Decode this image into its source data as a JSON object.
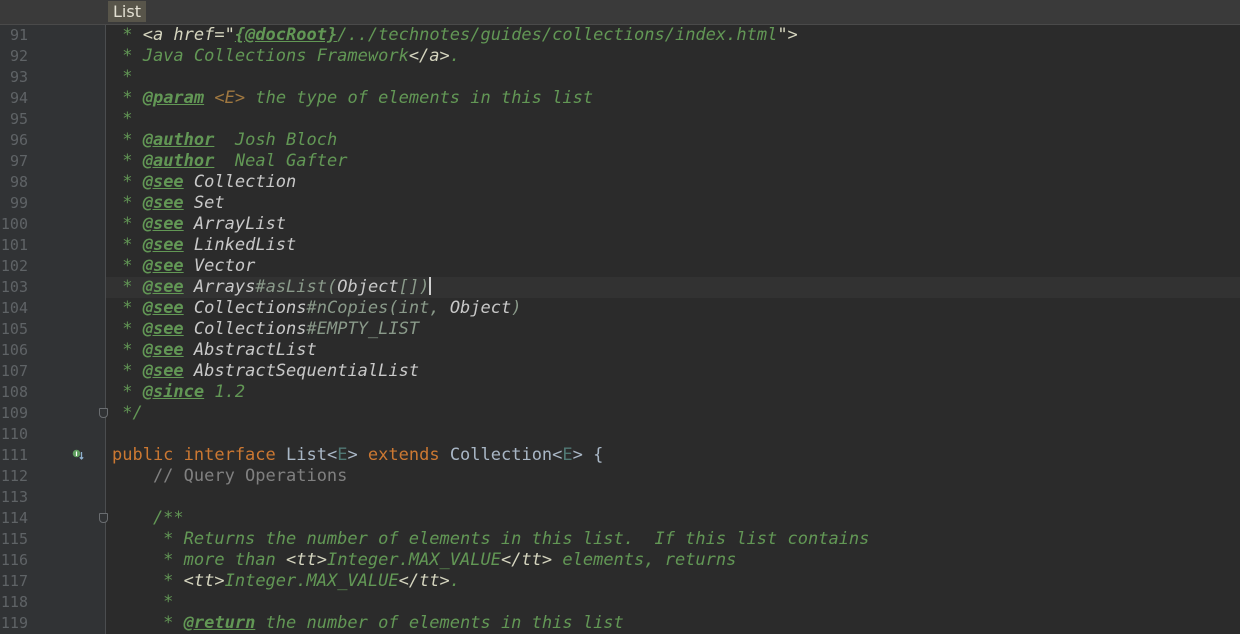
{
  "breadcrumb": {
    "label": "List"
  },
  "colors": {
    "doc": "#629755",
    "keyword": "#cc7832",
    "identifier": "#a9b7c6",
    "comment": "#808080"
  },
  "lines": [
    {
      "n": "91",
      "code": [
        [
          "doc",
          " * "
        ],
        [
          "html",
          "<a href=\""
        ],
        [
          "tag",
          "{@docRoot}"
        ],
        [
          "doc",
          "/../technotes/guides/collections/index.html"
        ],
        [
          "html",
          "\">"
        ]
      ]
    },
    {
      "n": "92",
      "code": [
        [
          "doc",
          " * Java Collections Framework"
        ],
        [
          "html",
          "</a>"
        ],
        [
          "doc",
          "."
        ]
      ]
    },
    {
      "n": "93",
      "code": [
        [
          "doc",
          " *"
        ]
      ]
    },
    {
      "n": "94",
      "code": [
        [
          "doc",
          " * "
        ],
        [
          "tag",
          "@param"
        ],
        [
          "doc",
          " "
        ],
        [
          "tp",
          "<E>"
        ],
        [
          "doc",
          " the type of elements in this list"
        ]
      ]
    },
    {
      "n": "95",
      "code": [
        [
          "doc",
          " *"
        ]
      ]
    },
    {
      "n": "96",
      "code": [
        [
          "doc",
          " * "
        ],
        [
          "tag",
          "@author"
        ],
        [
          "doc",
          "  Josh Bloch"
        ]
      ]
    },
    {
      "n": "97",
      "code": [
        [
          "doc",
          " * "
        ],
        [
          "tag",
          "@author"
        ],
        [
          "doc",
          "  Neal Gafter"
        ]
      ]
    },
    {
      "n": "98",
      "code": [
        [
          "doc",
          " * "
        ],
        [
          "tag",
          "@see"
        ],
        [
          "doc",
          " "
        ],
        [
          "refb",
          "Collection"
        ]
      ]
    },
    {
      "n": "99",
      "code": [
        [
          "doc",
          " * "
        ],
        [
          "tag",
          "@see"
        ],
        [
          "doc",
          " "
        ],
        [
          "refb",
          "Set"
        ]
      ]
    },
    {
      "n": "100",
      "code": [
        [
          "doc",
          " * "
        ],
        [
          "tag",
          "@see"
        ],
        [
          "doc",
          " "
        ],
        [
          "refb",
          "ArrayList"
        ]
      ]
    },
    {
      "n": "101",
      "code": [
        [
          "doc",
          " * "
        ],
        [
          "tag",
          "@see"
        ],
        [
          "doc",
          " "
        ],
        [
          "refb",
          "LinkedList"
        ]
      ]
    },
    {
      "n": "102",
      "code": [
        [
          "doc",
          " * "
        ],
        [
          "tag",
          "@see"
        ],
        [
          "doc",
          " "
        ],
        [
          "refb",
          "Vector"
        ]
      ]
    },
    {
      "n": "103",
      "code": [
        [
          "doc",
          " * "
        ],
        [
          "tag",
          "@see"
        ],
        [
          "doc",
          " "
        ],
        [
          "refb",
          "Arrays"
        ],
        [
          "ref",
          "#asList("
        ],
        [
          "refb",
          "Object"
        ],
        [
          "ref",
          "[])"
        ]
      ],
      "caret": true
    },
    {
      "n": "104",
      "code": [
        [
          "doc",
          " * "
        ],
        [
          "tag",
          "@see"
        ],
        [
          "doc",
          " "
        ],
        [
          "refb",
          "Collections"
        ],
        [
          "ref",
          "#nCopies(int, "
        ],
        [
          "refb",
          "Object"
        ],
        [
          "ref",
          ")"
        ]
      ]
    },
    {
      "n": "105",
      "code": [
        [
          "doc",
          " * "
        ],
        [
          "tag",
          "@see"
        ],
        [
          "doc",
          " "
        ],
        [
          "refb",
          "Collections"
        ],
        [
          "ref",
          "#EMPTY_LIST"
        ]
      ]
    },
    {
      "n": "106",
      "code": [
        [
          "doc",
          " * "
        ],
        [
          "tag",
          "@see"
        ],
        [
          "doc",
          " "
        ],
        [
          "refb",
          "AbstractList"
        ]
      ]
    },
    {
      "n": "107",
      "code": [
        [
          "doc",
          " * "
        ],
        [
          "tag",
          "@see"
        ],
        [
          "doc",
          " "
        ],
        [
          "refb",
          "AbstractSequentialList"
        ]
      ]
    },
    {
      "n": "108",
      "code": [
        [
          "doc",
          " * "
        ],
        [
          "tag",
          "@since"
        ],
        [
          "doc",
          " 1.2"
        ]
      ]
    },
    {
      "n": "109",
      "code": [
        [
          "doc",
          " */"
        ]
      ],
      "fold": true
    },
    {
      "n": "110",
      "code": []
    },
    {
      "n": "111",
      "code": [
        [
          "kw",
          "public interface "
        ],
        [
          "id",
          "List<"
        ],
        [
          "gen",
          "E"
        ],
        [
          "id",
          "> "
        ],
        [
          "kw",
          "extends "
        ],
        [
          "id",
          "Collection<"
        ],
        [
          "gen",
          "E"
        ],
        [
          "id",
          "> {"
        ]
      ],
      "impl": true
    },
    {
      "n": "112",
      "code": [
        [
          "cmt",
          "    // Query Operations"
        ]
      ]
    },
    {
      "n": "113",
      "code": []
    },
    {
      "n": "114",
      "code": [
        [
          "doc",
          "    /**"
        ]
      ],
      "fold": true
    },
    {
      "n": "115",
      "code": [
        [
          "doc",
          "     * Returns the number of elements in this list.  If this list contains"
        ]
      ]
    },
    {
      "n": "116",
      "code": [
        [
          "doc",
          "     * more than "
        ],
        [
          "html",
          "<tt>"
        ],
        [
          "doc",
          "Integer.MAX_VALUE"
        ],
        [
          "html",
          "</tt>"
        ],
        [
          "doc",
          " elements, returns"
        ]
      ]
    },
    {
      "n": "117",
      "code": [
        [
          "doc",
          "     * "
        ],
        [
          "html",
          "<tt>"
        ],
        [
          "doc",
          "Integer.MAX_VALUE"
        ],
        [
          "html",
          "</tt>"
        ],
        [
          "doc",
          "."
        ]
      ]
    },
    {
      "n": "118",
      "code": [
        [
          "doc",
          "     *"
        ]
      ]
    },
    {
      "n": "119",
      "code": [
        [
          "doc",
          "     * "
        ],
        [
          "tag",
          "@return"
        ],
        [
          "doc",
          " the number of elements in this list"
        ]
      ]
    }
  ]
}
